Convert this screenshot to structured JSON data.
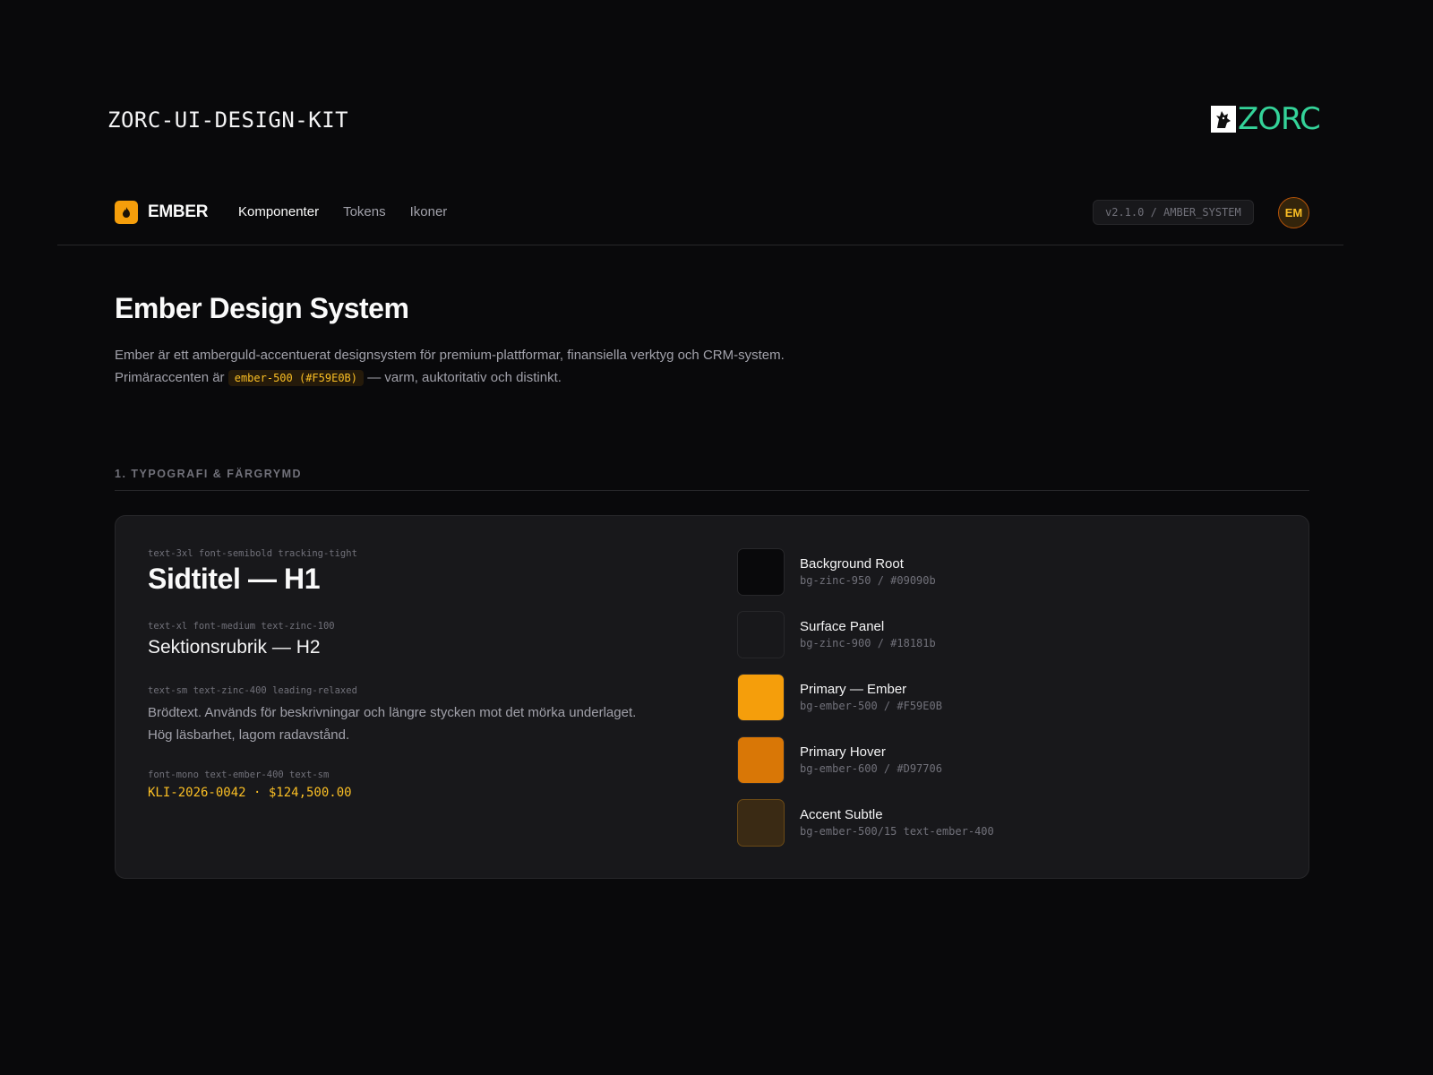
{
  "kit_title": "ZORC-UI-DESIGN-KIT",
  "logo": {
    "word": "ZORC",
    "accent": "#34d399"
  },
  "nav": {
    "brand": "EMBER",
    "links": [
      {
        "label": "Komponenter",
        "active": true
      },
      {
        "label": "Tokens",
        "active": false
      },
      {
        "label": "Ikoner",
        "active": false
      }
    ],
    "version": "v2.1.0 / AMBER_SYSTEM",
    "avatar": "EM"
  },
  "hero": {
    "title": "Ember Design System",
    "line1": "Ember är ett amberguld-accentuerat designsystem för premium-plattformar, finansiella verktyg och CRM-system.",
    "line2_prefix": "Primäraccenten är",
    "code": "ember-500 (#F59E0B)",
    "line2_suffix": "— varm, auktoritativ och distinkt."
  },
  "section": {
    "label": "1. TYPOGRAFI & FÄRGRYMD"
  },
  "typography": {
    "h1_hint": "text-3xl font-semibold tracking-tight",
    "h1_sample": "Sidtitel — H1",
    "h2_hint": "text-xl font-medium text-zinc-100",
    "h2_sample": "Sektionsrubrik — H2",
    "body_hint": "text-sm text-zinc-400 leading-relaxed",
    "body_line1": "Brödtext. Används för beskrivningar och längre stycken mot det mörka underlaget.",
    "body_line2": "Hög läsbarhet, lagom radavstånd.",
    "mono_hint": "font-mono text-ember-400 text-sm",
    "mono_sample": "KLI-2026-0042 · $124,500.00"
  },
  "swatches": [
    {
      "name": "Background Root",
      "code": "bg-zinc-950 / #09090b",
      "color": "#09090b"
    },
    {
      "name": "Surface Panel",
      "code": "bg-zinc-900 / #18181b",
      "color": "#18181b"
    },
    {
      "name": "Primary — Ember",
      "code": "bg-ember-500 / #F59E0B",
      "color": "#F59E0B"
    },
    {
      "name": "Primary Hover",
      "code": "bg-ember-600 / #D97706",
      "color": "#D97706"
    },
    {
      "name": "Accent Subtle",
      "code": "bg-ember-500/15 text-ember-400",
      "color": "#3a2a14"
    }
  ]
}
